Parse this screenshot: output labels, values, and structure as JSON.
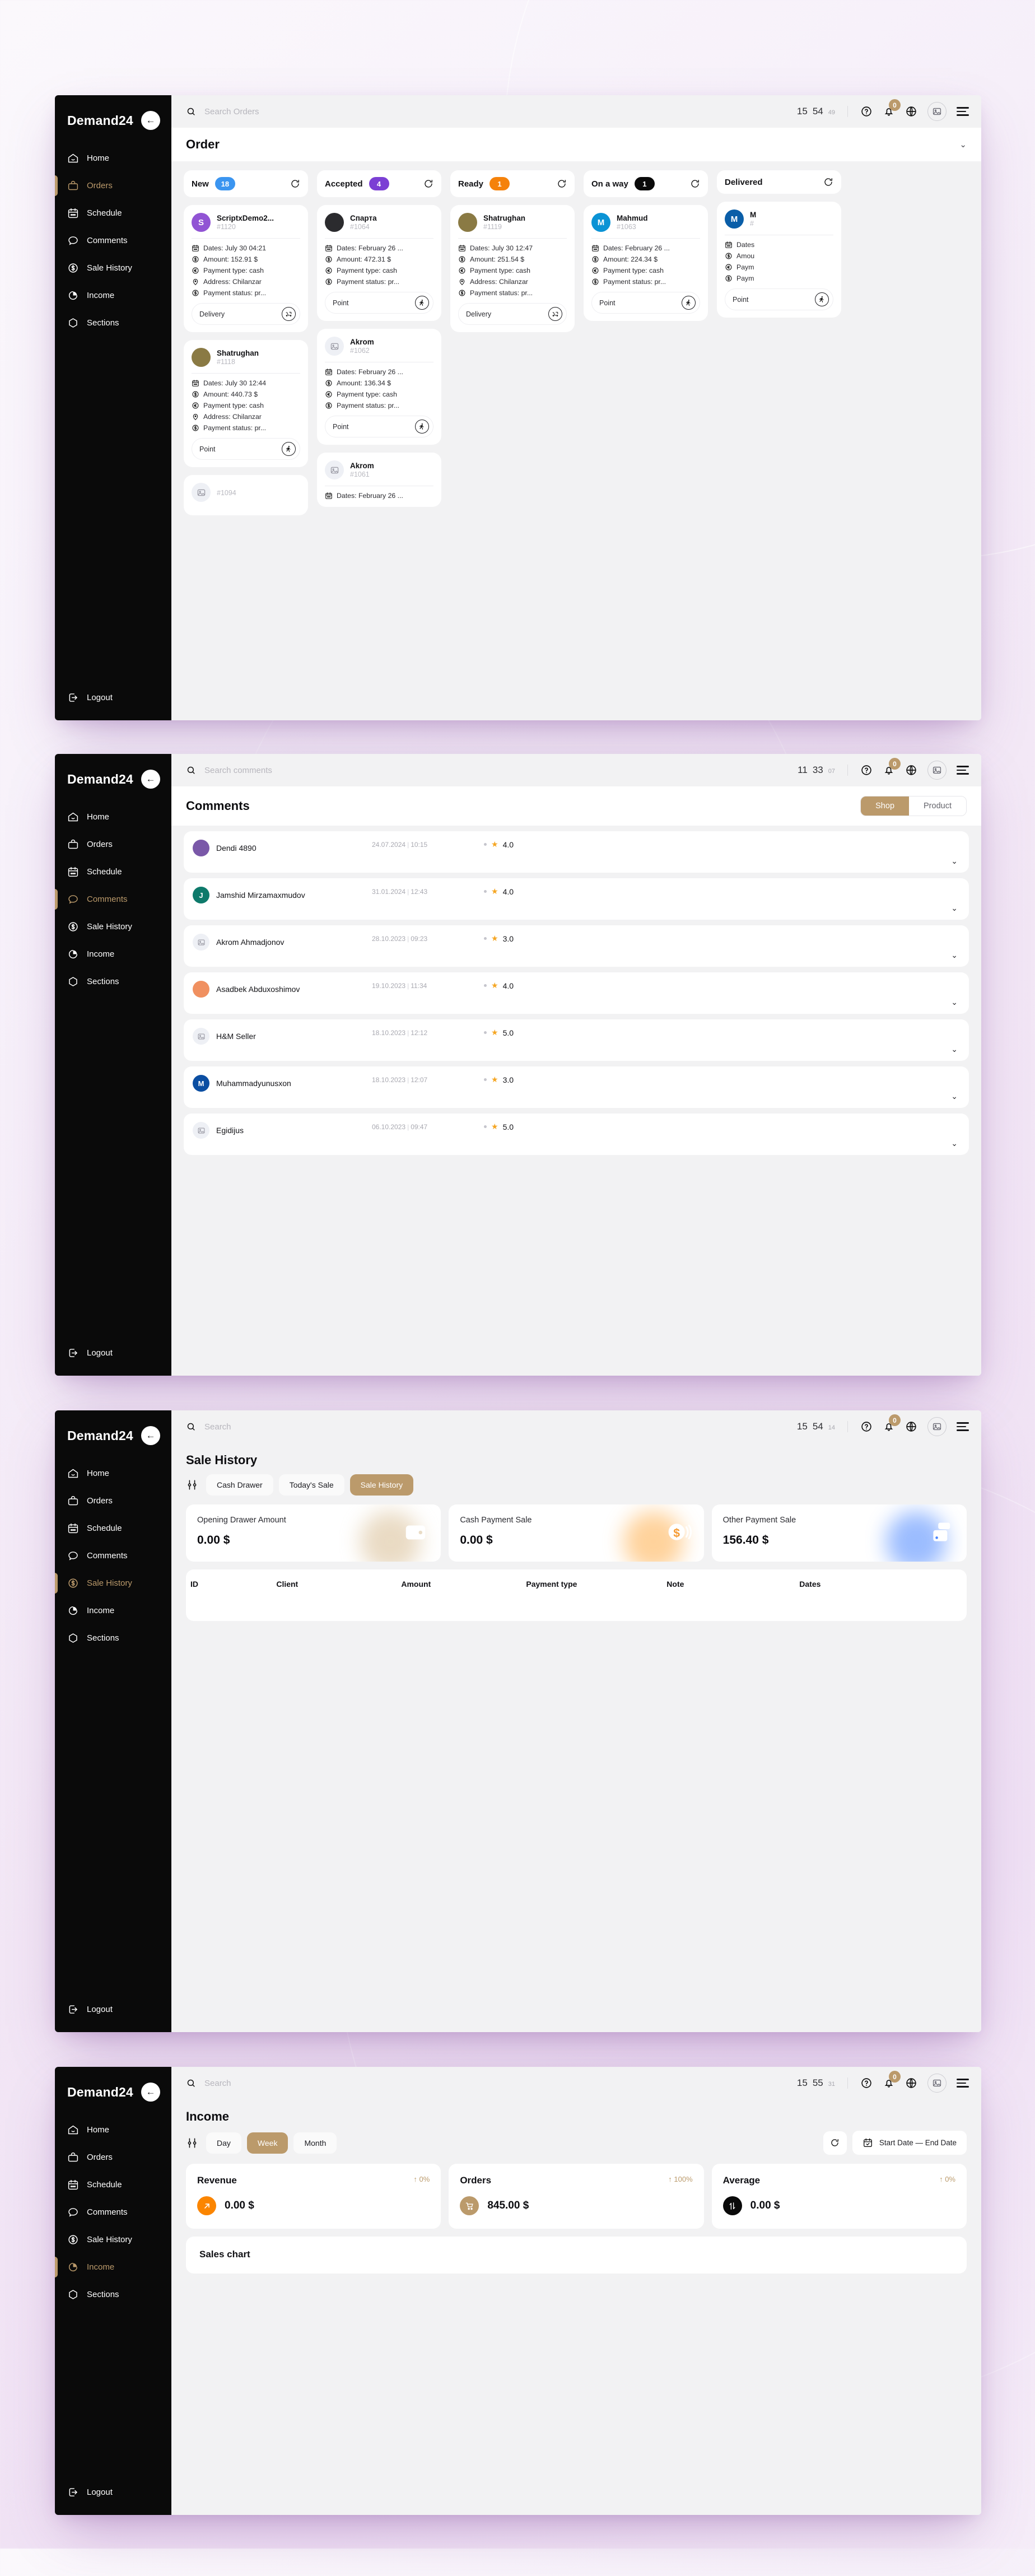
{
  "brand": {
    "name": "Demand24",
    "collapse_icon": "arrow-left-icon"
  },
  "sidebar": {
    "items": [
      {
        "label": "Home",
        "icon": "home-icon"
      },
      {
        "label": "Orders",
        "icon": "bag-icon"
      },
      {
        "label": "Schedule",
        "icon": "calendar-icon"
      },
      {
        "label": "Comments",
        "icon": "chat-bubble-icon"
      },
      {
        "label": "Sale History",
        "icon": "dollar-circle-icon"
      },
      {
        "label": "Income",
        "icon": "pie-chart-icon"
      },
      {
        "label": "Sections",
        "icon": "cube-icon"
      }
    ],
    "logout": {
      "label": "Logout",
      "icon": "logout-icon"
    }
  },
  "topbar_icons": {
    "search_icon": "search-icon",
    "help_icon": "question-circle-icon",
    "bell_icon": "bell-icon",
    "bell_badge": "0",
    "globe_icon": "globe-icon",
    "image_icon": "image-icon",
    "menu_icon": "hamburger-icon"
  },
  "colors": {
    "accent": "#bb9a6b",
    "sidebar": "#0a0a0a",
    "new": "#3b95f0",
    "accepted": "#7b3fd4",
    "ready": "#f5820b",
    "onaway": "#0a0a0a",
    "delivered": "#0a0a0a",
    "revenue": "#fb8500",
    "star": "#f5a623"
  },
  "panels": [
    {
      "id": "orders",
      "active_nav": "Orders",
      "search_placeholder": "Search Orders",
      "search_value": "",
      "clock": {
        "hh": "15",
        "mm": "54",
        "ss": "49"
      },
      "page_title": "Order",
      "columns": [
        {
          "name": "New",
          "count": "18",
          "color": "#3b95f0",
          "cards": [
            {
              "name": "ScriptxDemo2...",
              "id": "#1120",
              "avatar_kind": "initial",
              "initial": "S",
              "avatar_color": "#9154d4",
              "rows": [
                {
                  "icon": "calendar-icon",
                  "text": "Dates: July 30 04:21"
                },
                {
                  "icon": "dollar-circle-icon",
                  "text": "Amount: 152.91 $"
                },
                {
                  "icon": "euro-circle-icon",
                  "text": "Payment type: cash"
                },
                {
                  "icon": "pin-icon",
                  "text": "Address: Chilanzar"
                },
                {
                  "icon": "dollar-circle-icon",
                  "text": "Payment status: pr..."
                }
              ],
              "footer_label": "Delivery",
              "footer_icon": "scooter-icon"
            },
            {
              "name": "Shatrughan",
              "id": "#1118",
              "avatar_kind": "photo-man",
              "rows": [
                {
                  "icon": "calendar-icon",
                  "text": "Dates: July 30 12:44"
                },
                {
                  "icon": "dollar-circle-icon",
                  "text": "Amount: 440.73 $"
                },
                {
                  "icon": "euro-circle-icon",
                  "text": "Payment type: cash"
                },
                {
                  "icon": "pin-icon",
                  "text": "Address: Chilanzar"
                },
                {
                  "icon": "dollar-circle-icon",
                  "text": "Payment status: pr..."
                }
              ],
              "footer_label": "Point",
              "footer_icon": "walk-icon"
            },
            {
              "name": "",
              "id": "#1094",
              "avatar_kind": "placeholder",
              "rows": [],
              "footer_label": "",
              "footer_icon": ""
            }
          ]
        },
        {
          "name": "Accepted",
          "count": "4",
          "color": "#7b3fd4",
          "cards": [
            {
              "name": "Спарта",
              "id": "#1064",
              "avatar_kind": "photo-truck",
              "rows": [
                {
                  "icon": "calendar-icon",
                  "text": "Dates: February 26 ..."
                },
                {
                  "icon": "dollar-circle-icon",
                  "text": "Amount: 472.31 $"
                },
                {
                  "icon": "euro-circle-icon",
                  "text": "Payment type: cash"
                },
                {
                  "icon": "dollar-circle-icon",
                  "text": "Payment status: pr..."
                }
              ],
              "footer_label": "Point",
              "footer_icon": "walk-icon"
            },
            {
              "name": "Akrom",
              "id": "#1062",
              "avatar_kind": "placeholder",
              "rows": [
                {
                  "icon": "calendar-icon",
                  "text": "Dates: February 26 ..."
                },
                {
                  "icon": "dollar-circle-icon",
                  "text": "Amount: 136.34 $"
                },
                {
                  "icon": "euro-circle-icon",
                  "text": "Payment type: cash"
                },
                {
                  "icon": "dollar-circle-icon",
                  "text": "Payment status: pr..."
                }
              ],
              "footer_label": "Point",
              "footer_icon": "walk-icon"
            },
            {
              "name": "Akrom",
              "id": "#1061",
              "avatar_kind": "placeholder",
              "rows": [
                {
                  "icon": "calendar-icon",
                  "text": "Dates: February 26 ..."
                }
              ],
              "footer_label": "",
              "footer_icon": ""
            }
          ]
        },
        {
          "name": "Ready",
          "count": "1",
          "color": "#f5820b",
          "cards": [
            {
              "name": "Shatrughan",
              "id": "#1119",
              "avatar_kind": "photo-man",
              "rows": [
                {
                  "icon": "calendar-icon",
                  "text": "Dates: July 30 12:47"
                },
                {
                  "icon": "dollar-circle-icon",
                  "text": "Amount: 251.54 $"
                },
                {
                  "icon": "euro-circle-icon",
                  "text": "Payment type: cash"
                },
                {
                  "icon": "pin-icon",
                  "text": "Address: Chilanzar"
                },
                {
                  "icon": "dollar-circle-icon",
                  "text": "Payment status: pr..."
                }
              ],
              "footer_label": "Delivery",
              "footer_icon": "scooter-icon"
            }
          ]
        },
        {
          "name": "On a way",
          "count": "1",
          "color": "#0a0a0a",
          "cards": [
            {
              "name": "Mahmud",
              "id": "#1063",
              "avatar_kind": "initial",
              "initial": "M",
              "avatar_color": "#0b93d5",
              "rows": [
                {
                  "icon": "calendar-icon",
                  "text": "Dates: February 26 ..."
                },
                {
                  "icon": "dollar-circle-icon",
                  "text": "Amount: 224.34 $"
                },
                {
                  "icon": "euro-circle-icon",
                  "text": "Payment type: cash"
                },
                {
                  "icon": "dollar-circle-icon",
                  "text": "Payment status: pr..."
                }
              ],
              "footer_label": "Point",
              "footer_icon": "walk-icon"
            }
          ]
        },
        {
          "name": "Delivered",
          "count": "",
          "color": "#0a0a0a",
          "cards": [
            {
              "name": "M",
              "id": "#",
              "avatar_kind": "initial",
              "initial": "M",
              "avatar_color": "#0a5ea8",
              "rows": [
                {
                  "icon": "calendar-icon",
                  "text": "Dates"
                },
                {
                  "icon": "dollar-circle-icon",
                  "text": "Amou"
                },
                {
                  "icon": "euro-circle-icon",
                  "text": "Paym"
                },
                {
                  "icon": "dollar-circle-icon",
                  "text": "Paym"
                }
              ],
              "footer_label": "Point",
              "footer_icon": "walk-icon"
            }
          ]
        }
      ]
    },
    {
      "id": "comments",
      "active_nav": "Comments",
      "search_placeholder": "Search comments",
      "search_value": "",
      "clock": {
        "hh": "11",
        "mm": "33",
        "ss": "07"
      },
      "page_title": "Comments",
      "toggle": {
        "options": [
          "Shop",
          "Product"
        ],
        "selected": "Shop"
      },
      "rows": [
        {
          "name": "Dendi 4890",
          "date": "24.07.2024",
          "time": "10:15",
          "rating": "4.0",
          "avatar_kind": "photo",
          "avatar_color": "#7a58a8",
          "initial": ""
        },
        {
          "name": "Jamshid Mirzamaxmudov",
          "date": "31.01.2024",
          "time": "12:43",
          "rating": "4.0",
          "avatar_kind": "initial",
          "avatar_color": "#0e7a6b",
          "initial": "J"
        },
        {
          "name": "Akrom Ahmadjonov",
          "date": "28.10.2023",
          "time": "09:23",
          "rating": "3.0",
          "avatar_kind": "placeholder",
          "avatar_color": "",
          "initial": ""
        },
        {
          "name": "Asadbek Abduxoshimov",
          "date": "19.10.2023",
          "time": "11:34",
          "rating": "4.0",
          "avatar_kind": "photo",
          "avatar_color": "#f09060",
          "initial": ""
        },
        {
          "name": "H&M Seller",
          "date": "18.10.2023",
          "time": "12:12",
          "rating": "5.0",
          "avatar_kind": "placeholder",
          "avatar_color": "",
          "initial": ""
        },
        {
          "name": "Muhammadyunusxon",
          "date": "18.10.2023",
          "time": "12:07",
          "rating": "3.0",
          "avatar_kind": "initial",
          "avatar_color": "#0b4ea2",
          "initial": "M"
        },
        {
          "name": "Egidijus",
          "date": "06.10.2023",
          "time": "09:47",
          "rating": "5.0",
          "avatar_kind": "placeholder",
          "avatar_color": "",
          "initial": ""
        }
      ]
    },
    {
      "id": "sale-history",
      "active_nav": "Sale History",
      "search_placeholder": "Search",
      "search_value": "",
      "clock": {
        "hh": "15",
        "mm": "54",
        "ss": "14"
      },
      "page_title": "Sale History",
      "tabs": [
        {
          "label": "Cash Drawer",
          "selected": false
        },
        {
          "label": "Today's Sale",
          "selected": false
        },
        {
          "label": "Sale History",
          "selected": true
        }
      ],
      "stats": [
        {
          "label": "Opening Drawer Amount",
          "value": "0.00 $",
          "icon": "wallet-icon",
          "glow": "#d8bd93"
        },
        {
          "label": "Cash Payment Sale",
          "value": "0.00 $",
          "icon": "coin-sound-icon",
          "glow": "#ffae4a"
        },
        {
          "label": "Other Payment Sale",
          "value": "156.40 $",
          "icon": "card-icon",
          "glow": "#4a86ff"
        }
      ],
      "table": {
        "columns": [
          "ID",
          "Client",
          "Amount",
          "Payment type",
          "Note",
          "Dates"
        ],
        "rows": []
      }
    },
    {
      "id": "income",
      "active_nav": "Income",
      "search_placeholder": "Search",
      "search_value": "",
      "clock": {
        "hh": "15",
        "mm": "55",
        "ss": "31"
      },
      "page_title": "Income",
      "range_tabs": [
        {
          "label": "Day",
          "selected": false
        },
        {
          "label": "Week",
          "selected": true
        },
        {
          "label": "Month",
          "selected": false
        }
      ],
      "refresh_icon": "refresh-icon",
      "date_range": {
        "label": "Start Date — End Date",
        "icon": "calendar-check-icon"
      },
      "kpis": [
        {
          "name": "Revenue",
          "delta": "↑ 0%",
          "value": "0.00 $",
          "icon": "arrow-up-right-icon",
          "icon_bg": "#fb8500"
        },
        {
          "name": "Orders",
          "delta": "↑ 100%",
          "value": "845.00 $",
          "icon": "cart-icon",
          "icon_bg": "#bb9a6b"
        },
        {
          "name": "Average",
          "delta": "↑ 0%",
          "value": "0.00 $",
          "icon": "up-down-arrows-icon",
          "icon_bg": "#0a0a0a"
        }
      ],
      "chart_data": {
        "type": "line",
        "title": "Sales chart",
        "x": [],
        "series": [],
        "xlabel": "",
        "ylabel": "",
        "grid": false,
        "legend": "none"
      }
    }
  ]
}
